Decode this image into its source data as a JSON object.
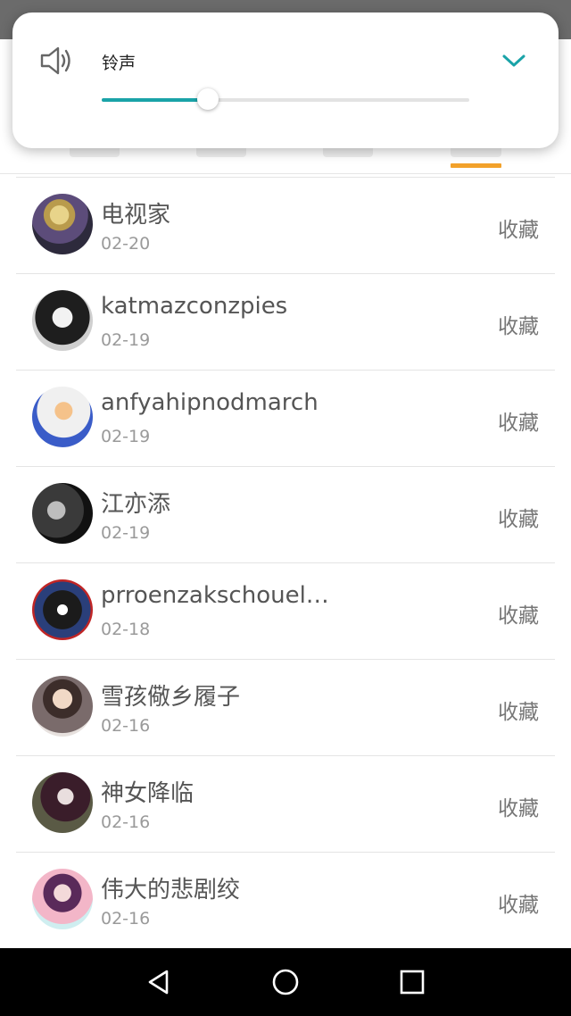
{
  "volume": {
    "label": "铃声",
    "level": 0.29,
    "icon": "speaker-icon",
    "expand_icon": "chevron-down-icon",
    "accent_color": "#1aa3a8"
  },
  "tabs": {
    "active_indicator_color": "#f2a12a"
  },
  "list": {
    "items": [
      {
        "name": "电视家",
        "date": "02-20",
        "action": "收藏"
      },
      {
        "name": "katmazconzpies",
        "date": "02-19",
        "action": "收藏"
      },
      {
        "name": "anfyahipnodmarch",
        "date": "02-19",
        "action": "收藏"
      },
      {
        "name": "江亦添",
        "date": "02-19",
        "action": "收藏"
      },
      {
        "name": "prroenzakschouel…",
        "date": "02-18",
        "action": "收藏"
      },
      {
        "name": "雪孩儆乡履子",
        "date": "02-16",
        "action": "收藏"
      },
      {
        "name": "神女降临",
        "date": "02-16",
        "action": "收藏"
      },
      {
        "name": "伟大的悲剧绞",
        "date": "02-16",
        "action": "收藏"
      }
    ]
  },
  "nav": {
    "back_icon": "back-triangle-icon",
    "home_icon": "home-circle-icon",
    "recents_icon": "recents-square-icon"
  }
}
